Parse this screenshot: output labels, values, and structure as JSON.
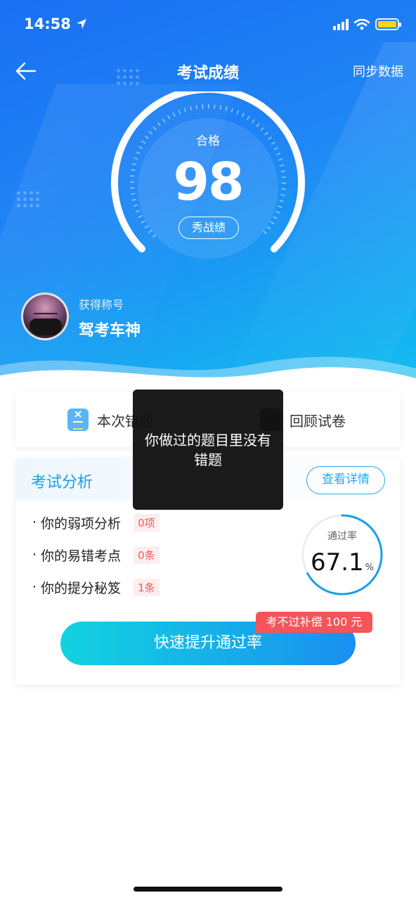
{
  "status_bar": {
    "time": "14:58"
  },
  "nav": {
    "title": "考试成绩",
    "sync_label": "同步数据"
  },
  "score": {
    "status": "合格",
    "value": "98",
    "share_label": "秀战绩"
  },
  "user": {
    "title_label": "获得称号",
    "title_name": "驾考车神"
  },
  "tabs": {
    "wrong_label": "本次错题",
    "review_label": "回顾试卷"
  },
  "analysis": {
    "title": "考试分析",
    "detail_label": "查看详情",
    "items": [
      {
        "label": "你的弱项分析",
        "badge": "0项"
      },
      {
        "label": "你的易错考点",
        "badge": "0条"
      },
      {
        "label": "你的提分秘笈",
        "badge": "1条"
      }
    ],
    "pass_rate": {
      "label": "通过率",
      "value": "67.1",
      "unit": "%"
    },
    "promo": "考不过补偿 100 元",
    "boost_label": "快速提升通过率"
  },
  "toast": {
    "message": "你做过的题目里没有错题"
  },
  "colors": {
    "accent": "#1d9ee6",
    "badge_red": "#ee5a5a",
    "promo_red": "#f5545a",
    "battery": "#ffd60a"
  }
}
